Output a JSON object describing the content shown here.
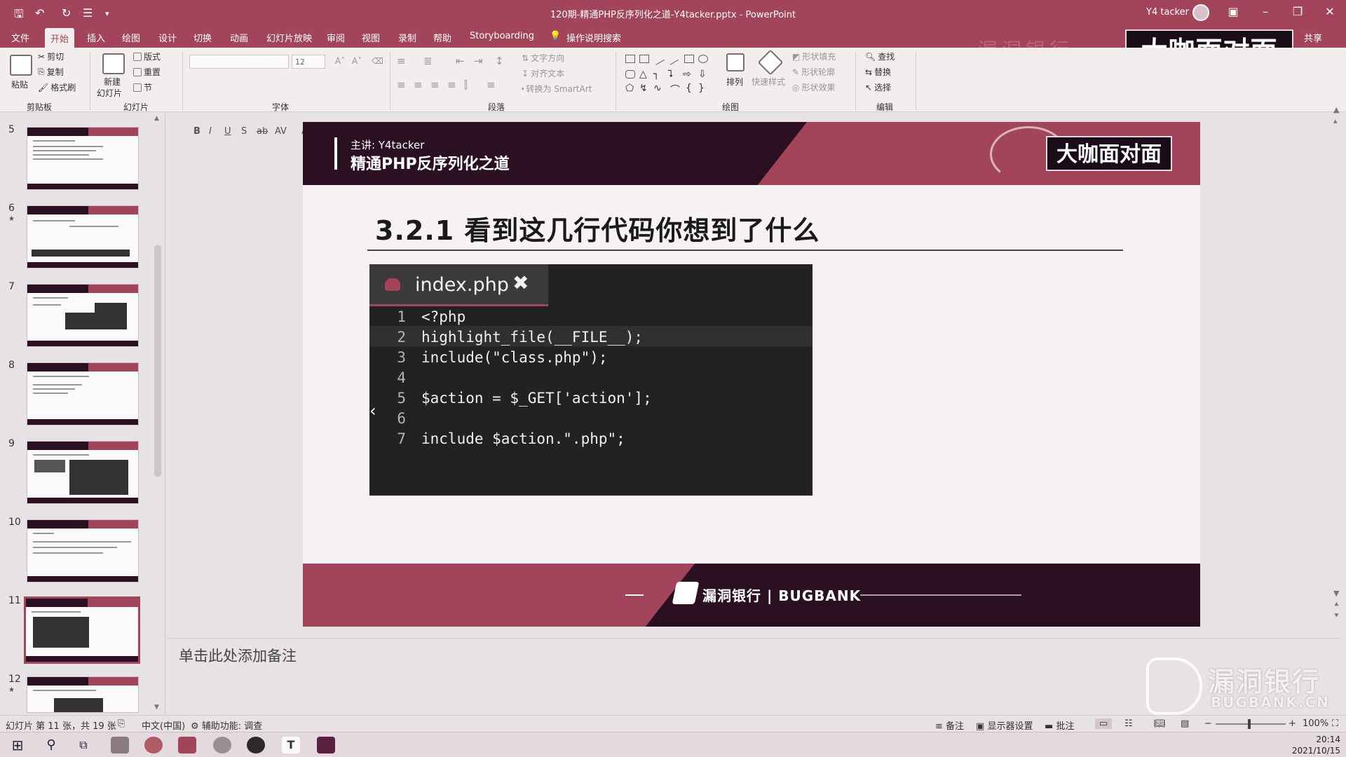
{
  "window": {
    "title": "120期-精通PHP反序列化之道-Y4tacker.pptx  -  PowerPoint",
    "user": "Y4 tacker"
  },
  "quick_access": [
    "save-icon",
    "undo-icon",
    "redo-icon",
    "customize-icon"
  ],
  "ribbon_tabs": [
    "文件",
    "开始",
    "插入",
    "绘图",
    "设计",
    "切换",
    "动画",
    "幻灯片放映",
    "审阅",
    "视图",
    "录制",
    "帮助",
    "Storyboarding",
    "操作说明搜索"
  ],
  "ribbon_active_tab": "开始",
  "share_label": "共享",
  "ribbon": {
    "clipboard": {
      "paste": "粘贴",
      "cut": "剪切",
      "copy": "复制",
      "format_painter": "格式刷",
      "label": "剪贴板"
    },
    "slides": {
      "new_slide_line1": "新建",
      "new_slide_line2": "幻灯片",
      "layout": "版式",
      "reset": "重置",
      "section": "节",
      "label": "幻灯片"
    },
    "font": {
      "size": "12",
      "label": "字体"
    },
    "paragraph": {
      "text_direction": "文字方向",
      "align_text": "对齐文本",
      "smartart": "转换为 SmartArt",
      "label": "段落"
    },
    "drawing": {
      "arrange": "排列",
      "quick_styles": "快速样式",
      "shape_fill": "形状填充",
      "shape_outline": "形状轮廓",
      "shape_effects": "形状效果",
      "label": "绘图"
    },
    "editing": {
      "find": "查找",
      "replace": "替换",
      "select": "选择",
      "label": "编辑"
    }
  },
  "watermark_top": "大咖面对面",
  "thumbnails": [
    {
      "num": "5",
      "star": false
    },
    {
      "num": "6",
      "star": true
    },
    {
      "num": "7",
      "star": false
    },
    {
      "num": "8",
      "star": false
    },
    {
      "num": "9",
      "star": false
    },
    {
      "num": "10",
      "star": false
    },
    {
      "num": "11",
      "star": false,
      "selected": true
    },
    {
      "num": "12",
      "star": true
    }
  ],
  "slide": {
    "lecturer": "主讲: Y4tacker",
    "course": "精通PHP反序列化之道",
    "logo": "大咖面对面",
    "title": "3.2.1 看到这几行代码你想到了什么",
    "code_filename": "index.php",
    "code_close": "✖",
    "code_lines": [
      {
        "n": "1",
        "code": "<?php"
      },
      {
        "n": "2",
        "code": "highlight_file(__FILE__);"
      },
      {
        "n": "3",
        "code": "include(\"class.php\");"
      },
      {
        "n": "4",
        "code": ""
      },
      {
        "n": "5",
        "code": "$action = $_GET['action'];"
      },
      {
        "n": "6",
        "code": ""
      },
      {
        "n": "7",
        "code": "include $action.\".php\";"
      }
    ],
    "footer_brand": "漏洞银行 | BUGBANK"
  },
  "notes_placeholder": "单击此处添加备注",
  "watermark_bottom": {
    "line1": "漏洞银行",
    "line2": "BUGBANK.CN"
  },
  "status": {
    "slide_info": "幻灯片 第 11 张，共 19 张",
    "language": "中文(中国)",
    "accessibility": "辅助功能: 调查",
    "notes": "备注",
    "display_settings": "显示器设置",
    "comments": "批注",
    "zoom": "100%"
  },
  "clock": {
    "time": "20:14",
    "date": "2021/10/15"
  },
  "colors": {
    "accent": "#a3455a",
    "dark": "#2b1022",
    "slide_bg": "#f7f3f4",
    "code_bg": "#222222"
  }
}
